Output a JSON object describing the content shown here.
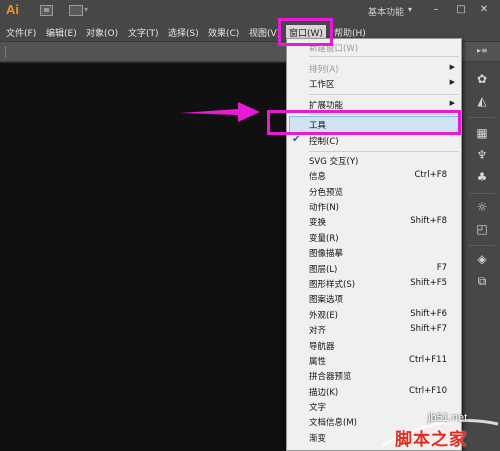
{
  "app": {
    "logo_text": "Ai",
    "workspace_label": "基本功能",
    "caret": "▾",
    "accent": "#f7941d"
  },
  "window_controls": {
    "minimize": "–",
    "maximize": "□",
    "close": "✕"
  },
  "menubar": {
    "items": [
      {
        "label": "文件(F)"
      },
      {
        "label": "编辑(E)"
      },
      {
        "label": "对象(O)"
      },
      {
        "label": "文字(T)"
      },
      {
        "label": "选择(S)"
      },
      {
        "label": "效果(C)"
      },
      {
        "label": "视图(V)"
      },
      {
        "label": "窗口(W)"
      },
      {
        "label": "帮助(H)"
      }
    ]
  },
  "controlbar": {
    "panel_menu_icon": "▸≡"
  },
  "window_menu": {
    "items": [
      {
        "label": "新建窗口(W)",
        "shortcut": "",
        "disabled": true
      },
      {
        "label": "排列(A)",
        "submenu": true,
        "disabled": true
      },
      {
        "label": "工作区",
        "submenu": true
      },
      {
        "label": "扩展功能",
        "submenu": true
      },
      {
        "label": "工具",
        "highlighted": true
      },
      {
        "label": "控制(C)",
        "checked": true
      },
      {
        "label": "SVG 交互(Y)"
      },
      {
        "label": "信息",
        "shortcut": "Ctrl+F8"
      },
      {
        "label": "分色预览"
      },
      {
        "label": "动作(N)"
      },
      {
        "label": "变换",
        "shortcut": "Shift+F8"
      },
      {
        "label": "变量(R)"
      },
      {
        "label": "图像描摹"
      },
      {
        "label": "图层(L)",
        "shortcut": "F7"
      },
      {
        "label": "图形样式(S)",
        "shortcut": "Shift+F5"
      },
      {
        "label": "图案选项"
      },
      {
        "label": "外观(E)",
        "shortcut": "Shift+F6"
      },
      {
        "label": "对齐",
        "shortcut": "Shift+F7"
      },
      {
        "label": "导航器"
      },
      {
        "label": "属性",
        "shortcut": "Ctrl+F11"
      },
      {
        "label": "拼合器预览"
      },
      {
        "label": "描边(K)",
        "shortcut": "Ctrl+F10"
      },
      {
        "label": "文字"
      },
      {
        "label": "文档信息(M)"
      },
      {
        "label": "渐变"
      }
    ],
    "check_mark": "✔",
    "submenu_arrow": "▶"
  },
  "dock": {
    "icons": [
      "color-icon",
      "color-guide-icon",
      "swatches-icon",
      "brushes-icon",
      "symbols-icon",
      "appearance-icon",
      "graphic-styles-icon",
      "layers-icon",
      "artboards-icon"
    ]
  },
  "annotation": {
    "highlight_color": "#e81ad7"
  },
  "watermark": {
    "site": "jb51.net",
    "brand": "脚本之家"
  }
}
